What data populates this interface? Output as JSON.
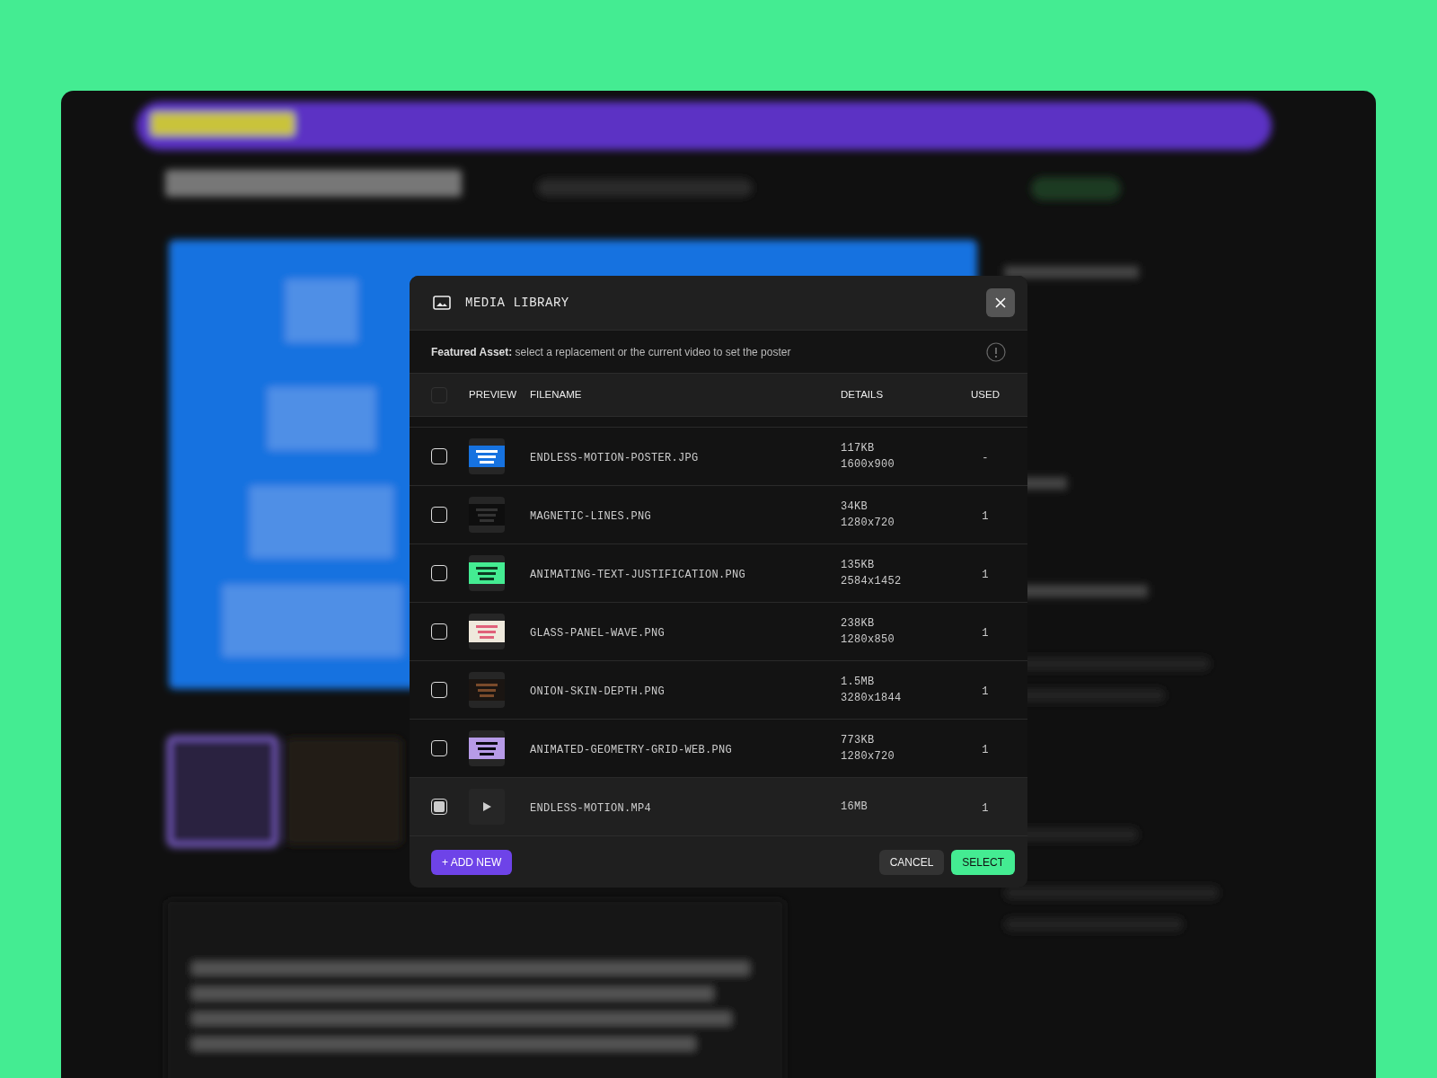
{
  "dialog": {
    "title": "MEDIA LIBRARY",
    "notice": "**Featured Asset:** select a replacement or the current video to set the poster",
    "select_all": {
      "checked": false
    },
    "columns": [
      "PREVIEW",
      "FILENAME",
      "DETAILS",
      "USED"
    ],
    "rows": [
      {
        "kind": "picture",
        "filename": "ENDLESS-MOTION-POSTER.JPG",
        "details": [
          "117KB",
          "1600x900"
        ],
        "used": "-",
        "selected": false
      },
      {
        "kind": "picture",
        "filename": "MAGNETIC-LINES.PNG",
        "details": [
          "34KB",
          "1280x720"
        ],
        "used": "1",
        "selected": false
      },
      {
        "kind": "picture",
        "filename": "ANIMATING-TEXT-JUSTIFICATION.PNG",
        "details": [
          "135KB",
          "2584x1452"
        ],
        "used": "1",
        "selected": false
      },
      {
        "kind": "picture",
        "filename": "GLASS-PANEL-WAVE.PNG",
        "details": [
          "238KB",
          "1280x850"
        ],
        "used": "1",
        "selected": false
      },
      {
        "kind": "picture",
        "filename": "ONION-SKIN-DEPTH.PNG",
        "details": [
          "1.5MB",
          "3280x1844"
        ],
        "used": "1",
        "selected": false
      },
      {
        "kind": "picture",
        "filename": "ANIMATED-GEOMETRY-GRID-WEB.PNG",
        "details": [
          "773KB",
          "1280x720"
        ],
        "used": "1",
        "selected": false
      },
      {
        "kind": "video",
        "filename": "ENDLESS-MOTION.MP4",
        "details": [
          "16MB"
        ],
        "used": "1",
        "selected": true
      }
    ],
    "add_button": "+ ADD NEW",
    "cancel_button": "CANCEL",
    "select_button": "SELECT"
  }
}
